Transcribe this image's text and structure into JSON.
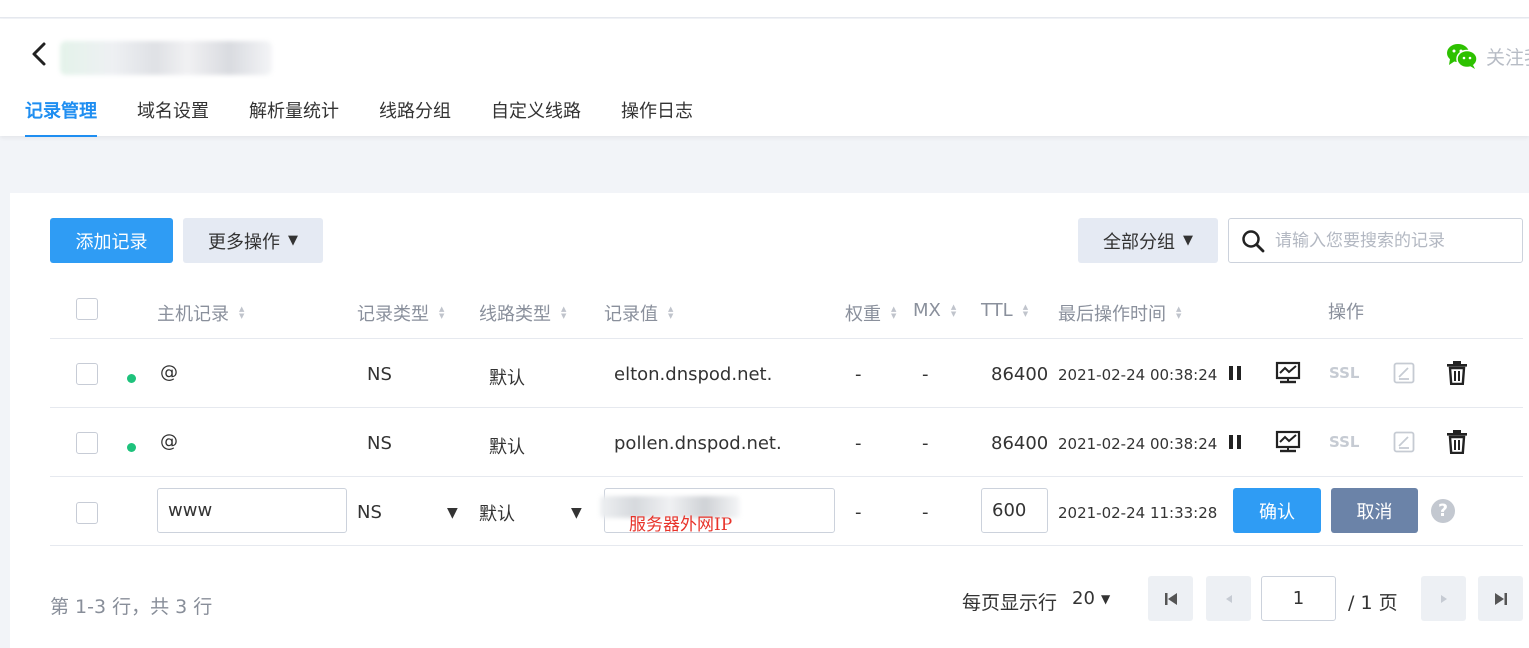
{
  "header": {
    "follow_label": "关注我",
    "tabs": [
      {
        "label": "记录管理",
        "active": true
      },
      {
        "label": "域名设置"
      },
      {
        "label": "解析量统计"
      },
      {
        "label": "线路分组"
      },
      {
        "label": "自定义线路"
      },
      {
        "label": "操作日志"
      }
    ]
  },
  "toolbar": {
    "add_label": "添加记录",
    "more_label": "更多操作",
    "group_label": "全部分组",
    "search_placeholder": "请输入您要搜索的记录"
  },
  "table": {
    "headers": {
      "host": "主机记录",
      "type": "记录类型",
      "line": "线路类型",
      "value": "记录值",
      "weight": "权重",
      "mx": "MX",
      "ttl": "TTL",
      "updated": "最后操作时间",
      "actions": "操作"
    },
    "rows": [
      {
        "host": "@",
        "type": "NS",
        "line": "默认",
        "value": "elton.dnspod.net.",
        "weight": "-",
        "mx": "-",
        "ttl": "86400",
        "updated": "2021-02-24 00:38:24",
        "ssl": "SSL",
        "status_color": "#1ec27c"
      },
      {
        "host": "@",
        "type": "NS",
        "line": "默认",
        "value": "pollen.dnspod.net.",
        "weight": "-",
        "mx": "-",
        "ttl": "86400",
        "updated": "2021-02-24 00:38:24",
        "ssl": "SSL",
        "status_color": "#1ec27c"
      }
    ],
    "edit_row": {
      "host": "www",
      "type": "NS",
      "line": "默认",
      "value_note": "服务器外网IP",
      "weight": "-",
      "mx": "-",
      "ttl": "600",
      "updated": "2021-02-24 11:33:28",
      "confirm_label": "确认",
      "cancel_label": "取消",
      "help_glyph": "?"
    }
  },
  "footer": {
    "summary": "第 1-3 行，共 3 行",
    "page_size_label": "每页显示行",
    "page_size": "20",
    "current_page": "1",
    "total_pages": "/ 1 页"
  },
  "colors": {
    "primary": "#2f9cf4",
    "active_tab": "#1f8ef1",
    "cancel": "#6b83a8",
    "status_ok": "#1ec27c",
    "annotation": "#e8332a"
  }
}
